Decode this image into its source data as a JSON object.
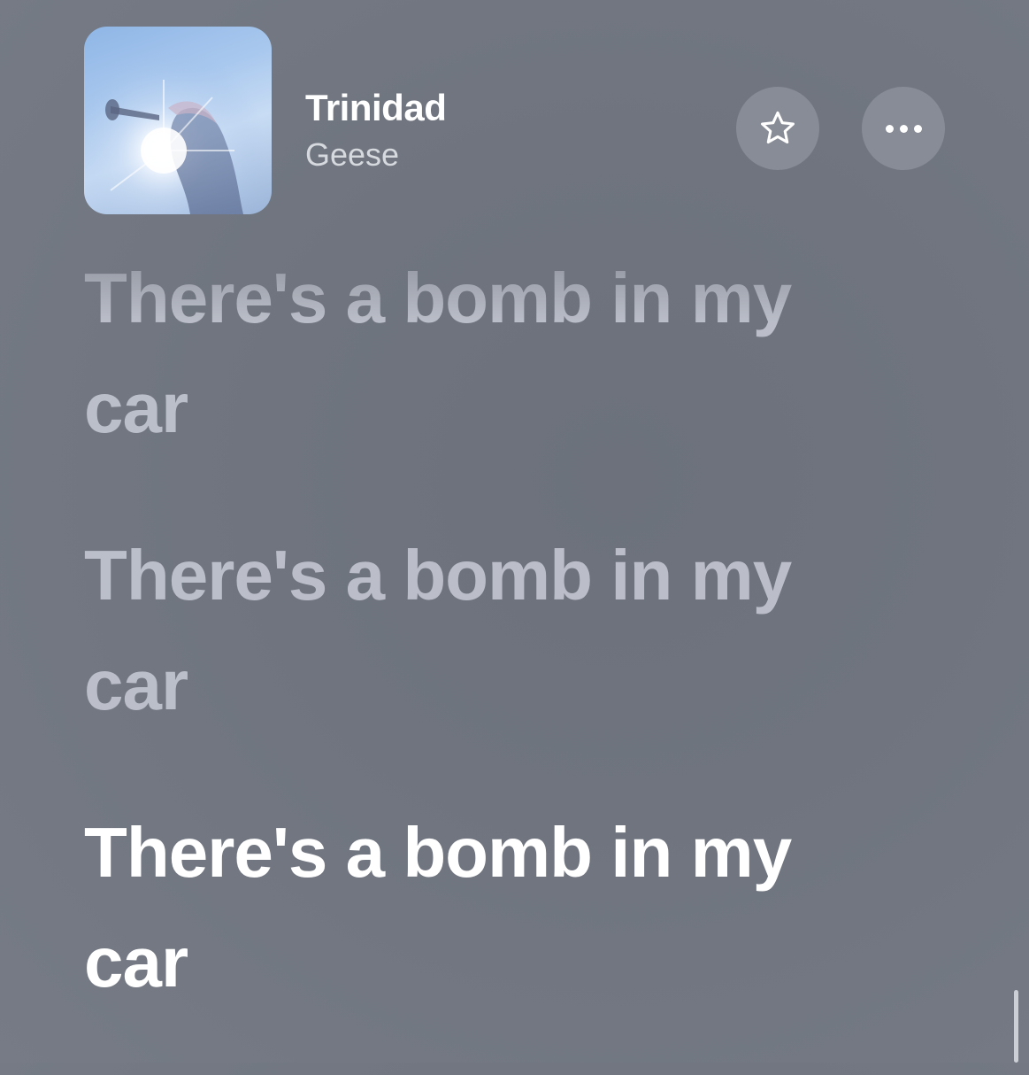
{
  "now_playing": {
    "title": "Trinidad",
    "artist": "Geese",
    "artwork_icon": "album-artwork"
  },
  "actions": {
    "favorite_icon": "star-icon",
    "more_icon": "ellipsis-icon"
  },
  "lyrics": [
    {
      "text": "There's a bomb in my car",
      "state": "past"
    },
    {
      "text": "There's a bomb in my car",
      "state": "past"
    },
    {
      "text": "There's a bomb in my car",
      "state": "current"
    }
  ],
  "colors": {
    "background": "#71767f",
    "active_lyric": "#ffffff",
    "inactive_lyric": "#c9ccd6",
    "button_bg": "#8c919a"
  }
}
